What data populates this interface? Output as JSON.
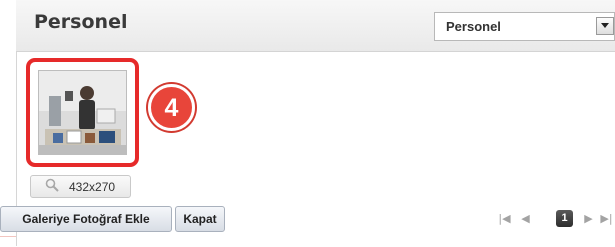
{
  "header": {
    "title": "Personel",
    "select_value": "Personel"
  },
  "gallery": {
    "badge_number": "4",
    "image_size": "432x270"
  },
  "actions": {
    "add_label": "Galeriye Fotoğraf Ekle",
    "close_label": "Kapat"
  },
  "pager": {
    "first_icon": "first-page-icon",
    "prev_icon": "prev-page-icon",
    "current_page": "1",
    "next_icon": "next-page-icon",
    "last_icon": "last-page-icon"
  },
  "colors": {
    "highlight": "#e62a2a",
    "badge": "#e8453a"
  }
}
